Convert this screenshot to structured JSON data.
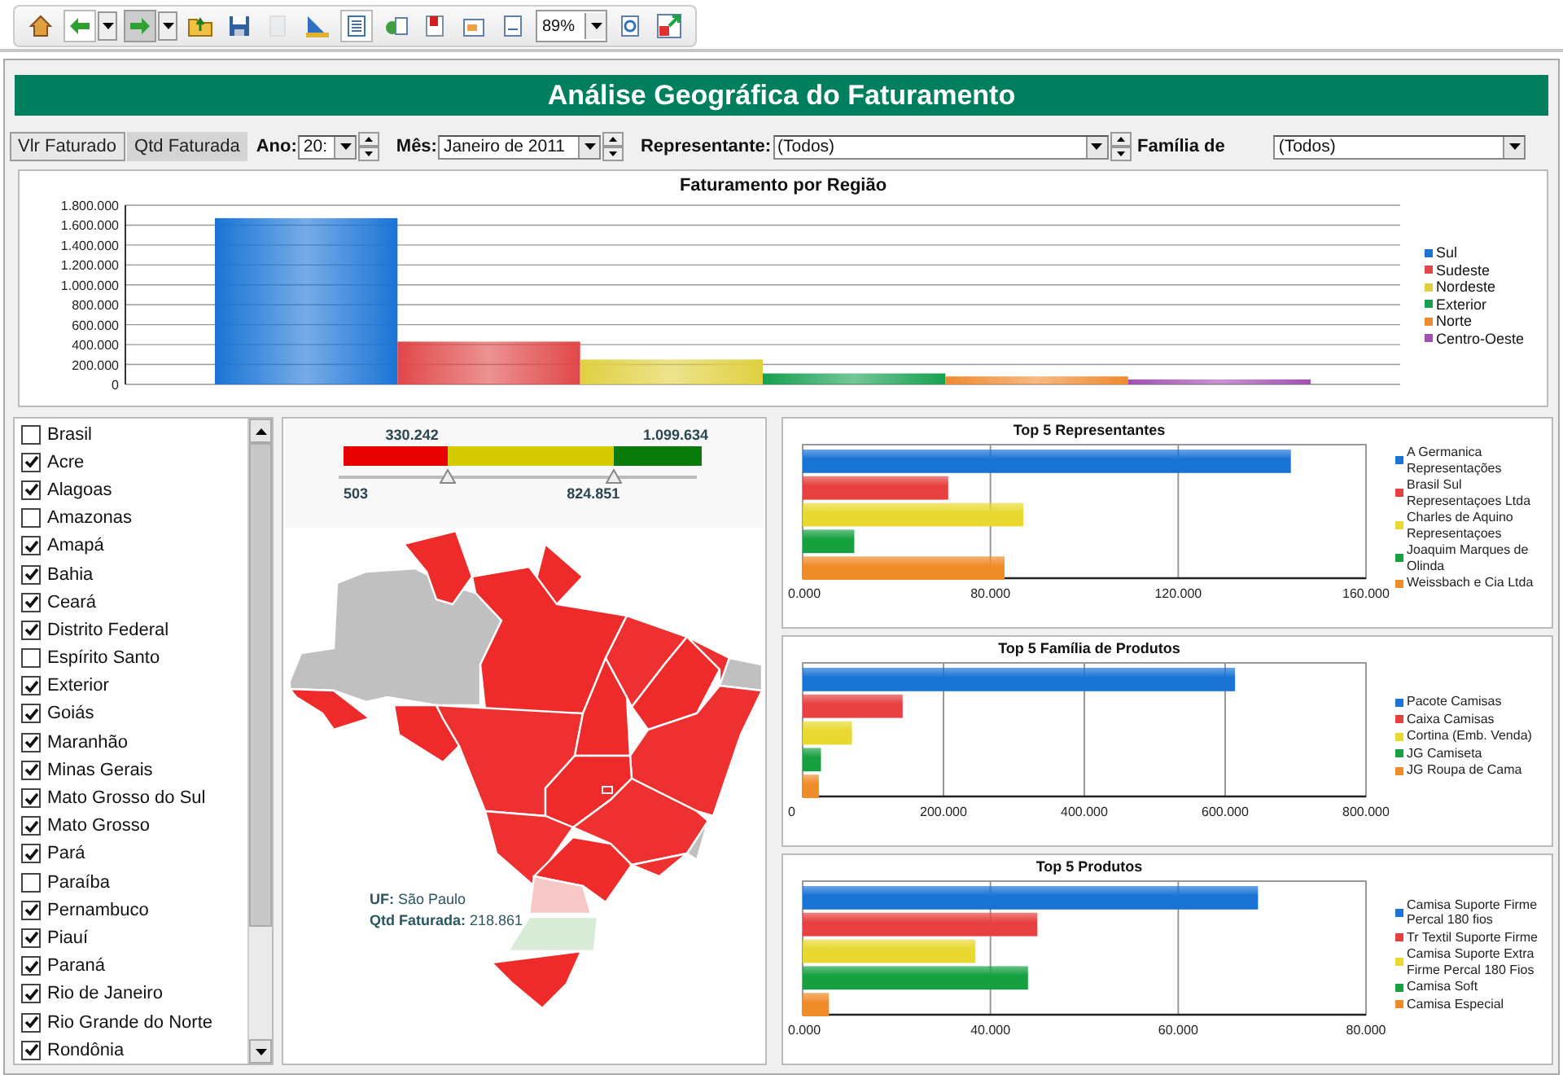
{
  "toolbar": {
    "zoom": "89%"
  },
  "title": "Análise Geográfica do Faturamento",
  "measures": [
    {
      "label": "Vlr Faturado",
      "selected": false
    },
    {
      "label": "Qtd Faturada",
      "selected": true
    }
  ],
  "filters": [
    {
      "label": "Ano:",
      "value": "20:",
      "kind": "spinner"
    },
    {
      "label": "Mês:",
      "value": "Janeiro de 2011",
      "kind": "spinner"
    },
    {
      "label": "Representante:",
      "value": "(Todos)",
      "kind": "spinner"
    },
    {
      "label": "Família de",
      "value": "(Todos)",
      "kind": "select"
    }
  ],
  "region_chart": {
    "chart_data": {
      "type": "bar",
      "title": "Faturamento por Região",
      "grid": true,
      "legend": "right",
      "ylim": [
        0,
        1800000
      ],
      "yticks": [
        {
          "value": 0,
          "label": "0"
        },
        {
          "value": 200000,
          "label": "200.000"
        },
        {
          "value": 400000,
          "label": "400.000"
        },
        {
          "value": 600000,
          "label": "600.000"
        },
        {
          "value": 800000,
          "label": "800.000"
        },
        {
          "value": 1000000,
          "label": "1.000.000"
        },
        {
          "value": 1200000,
          "label": "1.200.000"
        },
        {
          "value": 1400000,
          "label": "1.400.000"
        },
        {
          "value": 1600000,
          "label": "1.600.000"
        },
        {
          "value": 1800000,
          "label": "1.800.000"
        }
      ],
      "series": [
        {
          "name": "Sul",
          "color": "#1a74d6",
          "values": [
            1670000
          ]
        },
        {
          "name": "Sudeste",
          "color": "#e04848",
          "values": [
            430000
          ]
        },
        {
          "name": "Nordeste",
          "color": "#e0d040",
          "values": [
            250000
          ]
        },
        {
          "name": "Exterior",
          "color": "#16a050",
          "values": [
            110000
          ]
        },
        {
          "name": "Norte",
          "color": "#ee8a30",
          "values": [
            80000
          ]
        },
        {
          "name": "Centro-Oeste",
          "color": "#a050b0",
          "values": [
            50000
          ]
        }
      ]
    }
  },
  "states": [
    {
      "label": "Brasil",
      "checked": false
    },
    {
      "label": "Acre",
      "checked": true
    },
    {
      "label": "Alagoas",
      "checked": true
    },
    {
      "label": "Amazonas",
      "checked": false
    },
    {
      "label": "Amapá",
      "checked": true
    },
    {
      "label": "Bahia",
      "checked": true
    },
    {
      "label": "Ceará",
      "checked": true
    },
    {
      "label": "Distrito Federal",
      "checked": true
    },
    {
      "label": "Espírito Santo",
      "checked": false
    },
    {
      "label": "Exterior",
      "checked": true
    },
    {
      "label": "Goiás",
      "checked": true
    },
    {
      "label": "Maranhão",
      "checked": true
    },
    {
      "label": "Minas Gerais",
      "checked": true
    },
    {
      "label": "Mato Grosso do Sul",
      "checked": true
    },
    {
      "label": "Mato Grosso",
      "checked": true
    },
    {
      "label": "Pará",
      "checked": true
    },
    {
      "label": "Paraíba",
      "checked": false
    },
    {
      "label": "Pernambuco",
      "checked": true
    },
    {
      "label": "Piauí",
      "checked": true
    },
    {
      "label": "Paraná",
      "checked": true
    },
    {
      "label": "Rio de Janeiro",
      "checked": true
    },
    {
      "label": "Rio Grande do Norte",
      "checked": true
    },
    {
      "label": "Rondônia",
      "checked": true
    }
  ],
  "map": {
    "scale": {
      "min": "503",
      "max": "1.099.634",
      "thumbs": [
        {
          "label": "330.242",
          "level": 0.29
        },
        {
          "label": "824.851",
          "level": 0.755
        }
      ]
    },
    "tooltip": [
      "**UF:** São Paulo",
      "**Qtd Faturada:** 218.861"
    ]
  },
  "top_charts": [
    {
      "axis_edge_label": "0.000",
      "chart_data": {
        "type": "bar",
        "orientation": "horizontal",
        "title": "Top 5 Representantes",
        "grid": true,
        "legend": "right",
        "xlim": [
          40000,
          160000
        ],
        "xticks": [
          {
            "value": 80000,
            "label": "80.000"
          },
          {
            "value": 120000,
            "label": "120.000"
          },
          {
            "value": 160000,
            "label": "160.000"
          }
        ],
        "series": [
          {
            "name": "A Germanica Representações",
            "color": "#1a74d6",
            "values": [
              144000
            ]
          },
          {
            "name": "Brasil Sul Representaçoes Ltda",
            "color": "#e84040",
            "values": [
              71000
            ]
          },
          {
            "name": "Charles de Aquino Representaçoes",
            "color": "#e8d830",
            "values": [
              87000
            ]
          },
          {
            "name": "Joaquim Marques de Olinda",
            "color": "#16a040",
            "values": [
              51000
            ]
          },
          {
            "name": "Weissbach e Cia Ltda",
            "color": "#f08c28",
            "values": [
              83000
            ]
          }
        ]
      }
    },
    {
      "chart_data": {
        "type": "bar",
        "orientation": "horizontal",
        "title": "Top 5 Família de Produtos",
        "grid": true,
        "legend": "right",
        "xlim": [
          0,
          800000
        ],
        "xticks": [
          {
            "value": 0,
            "label": "0"
          },
          {
            "value": 200000,
            "label": "200.000"
          },
          {
            "value": 400000,
            "label": "400.000"
          },
          {
            "value": 600000,
            "label": "600.000"
          },
          {
            "value": 800000,
            "label": "800.000"
          }
        ],
        "series": [
          {
            "name": "Pacote Camisas",
            "color": "#1a74d6",
            "values": [
              614000
            ]
          },
          {
            "name": "Caixa Camisas",
            "color": "#e84040",
            "values": [
              142000
            ]
          },
          {
            "name": "Cortina (Emb. Venda)",
            "color": "#e8d830",
            "values": [
              70000
            ]
          },
          {
            "name": "JG Camiseta",
            "color": "#16a040",
            "values": [
              26000
            ]
          },
          {
            "name": "JG Roupa de Cama",
            "color": "#f08c28",
            "values": [
              23000
            ]
          }
        ]
      }
    },
    {
      "axis_edge_label": "0.000",
      "chart_data": {
        "type": "bar",
        "orientation": "horizontal",
        "title": "Top 5 Produtos",
        "grid": true,
        "legend": "right",
        "xlim": [
          20000,
          80000
        ],
        "xticks": [
          {
            "value": 40000,
            "label": "40.000"
          },
          {
            "value": 60000,
            "label": "60.000"
          },
          {
            "value": 80000,
            "label": "80.000"
          }
        ],
        "series": [
          {
            "name": "Camisa Suporte Firme Percal 180 fios",
            "color": "#1a74d6",
            "values": [
              68500
            ]
          },
          {
            "name": "Tr Textil Suporte Firme",
            "color": "#e84040",
            "values": [
              45000
            ]
          },
          {
            "name": "Camisa Suporte Extra Firme Percal 180 Fios",
            "color": "#e8d830",
            "values": [
              38400
            ]
          },
          {
            "name": "Camisa Soft",
            "color": "#16a040",
            "values": [
              44000
            ]
          },
          {
            "name": "Camisa Especial",
            "color": "#f08c28",
            "values": [
              22800
            ]
          }
        ]
      }
    }
  ]
}
